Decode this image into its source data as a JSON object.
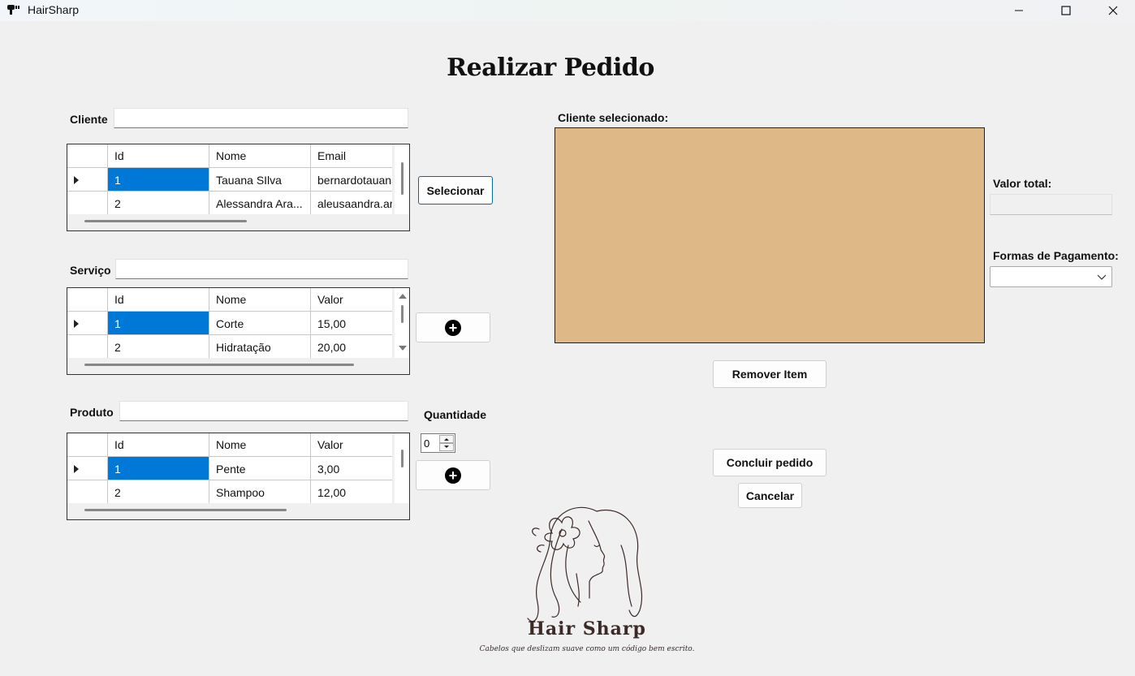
{
  "window": {
    "title": "HairSharp",
    "colors": {
      "background": "#f0f0f0",
      "cart": "#deb887",
      "selection": "#0078d7",
      "brand": "#3d2a26"
    }
  },
  "page": {
    "title": "Realizar Pedido"
  },
  "cliente": {
    "label": "Cliente",
    "search_value": "",
    "columns": [
      "Id",
      "Nome",
      "Email"
    ],
    "rows": [
      {
        "id": "1",
        "nome": "Tauana SIlva",
        "extra": "bernardotauana"
      },
      {
        "id": "2",
        "nome": "Alessandra Ara...",
        "extra": "aleusaandra.ar"
      }
    ],
    "select_button": "Selecionar"
  },
  "servico": {
    "label": "Serviço",
    "search_value": "",
    "columns": [
      "Id",
      "Nome",
      "Valor"
    ],
    "rows": [
      {
        "id": "1",
        "nome": "Corte",
        "extra": "15,00"
      },
      {
        "id": "2",
        "nome": "Hidratação",
        "extra": "20,00"
      }
    ],
    "add_icon": "plus-circle-icon"
  },
  "produto": {
    "label": "Produto",
    "search_value": "",
    "columns": [
      "Id",
      "Nome",
      "Valor"
    ],
    "rows": [
      {
        "id": "1",
        "nome": "Pente",
        "extra": "3,00"
      },
      {
        "id": "2",
        "nome": "Shampoo",
        "extra": "12,00"
      }
    ],
    "add_icon": "plus-circle-icon"
  },
  "quantidade": {
    "label": "Quantidade",
    "value": "0"
  },
  "pedido": {
    "cliente_selecionado_label": "Cliente selecionado:",
    "valor_total_label": "Valor total:",
    "valor_total_value": "",
    "formas_pagamento_label": "Formas de Pagamento:",
    "forma_pagamento_selected": "",
    "remover_button": "Remover Item",
    "concluir_button": "Concluir pedido",
    "cancelar_button": "Cancelar"
  },
  "brand": {
    "name": "Hair Sharp",
    "tagline": "Cabelos que deslizam suave como um código bem escrito."
  }
}
